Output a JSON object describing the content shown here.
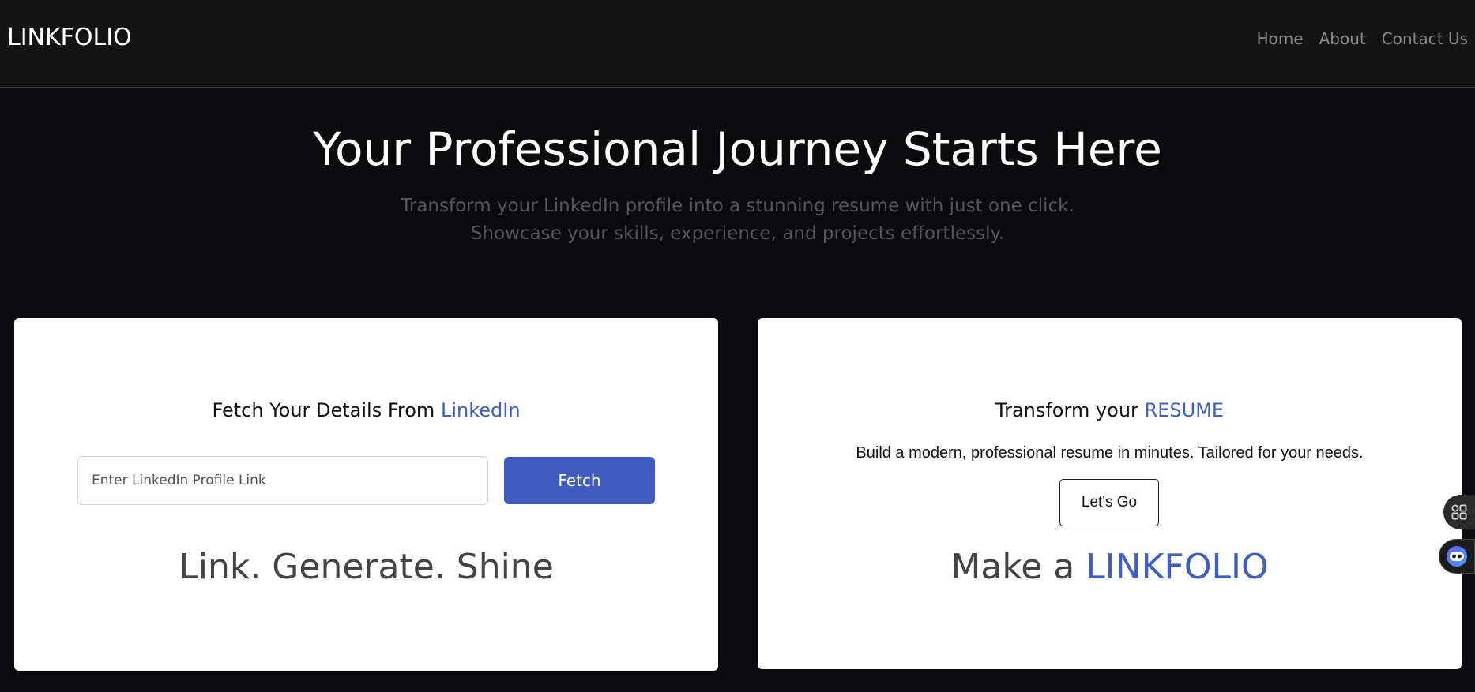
{
  "navbar": {
    "brand": "LINKFOLIO",
    "links": [
      {
        "label": "Home"
      },
      {
        "label": "About"
      },
      {
        "label": "Contact Us"
      }
    ]
  },
  "hero": {
    "title": "Your Professional Journey Starts Here",
    "subtitle": "Transform your LinkedIn profile into a stunning resume with just one click. Showcase your skills, experience, and projects effortlessly."
  },
  "fetch_card": {
    "heading_prefix": "Fetch Your Details From ",
    "heading_accent": "LinkedIn",
    "input_placeholder": "Enter LinkedIn Profile Link",
    "input_value": "",
    "button_label": "Fetch",
    "tagline": "Link. Generate. Shine"
  },
  "resume_card": {
    "heading_prefix": "Transform your ",
    "heading_accent": "RESUME",
    "description": "Build a modern, professional resume in minutes. Tailored for your needs.",
    "button_label": "Let's Go",
    "title_prefix": "Make a ",
    "title_accent": "LINKFOLIO"
  },
  "floating": {
    "apps_icon": "apps-grid-icon",
    "assistant_icon": "assistant-bot-icon"
  },
  "colors": {
    "page_bg": "#0b0b0d",
    "navbar_bg": "#141414",
    "accent": "#3f5fbf",
    "button_primary": "#3f5bbf",
    "muted_text": "#55555f"
  }
}
